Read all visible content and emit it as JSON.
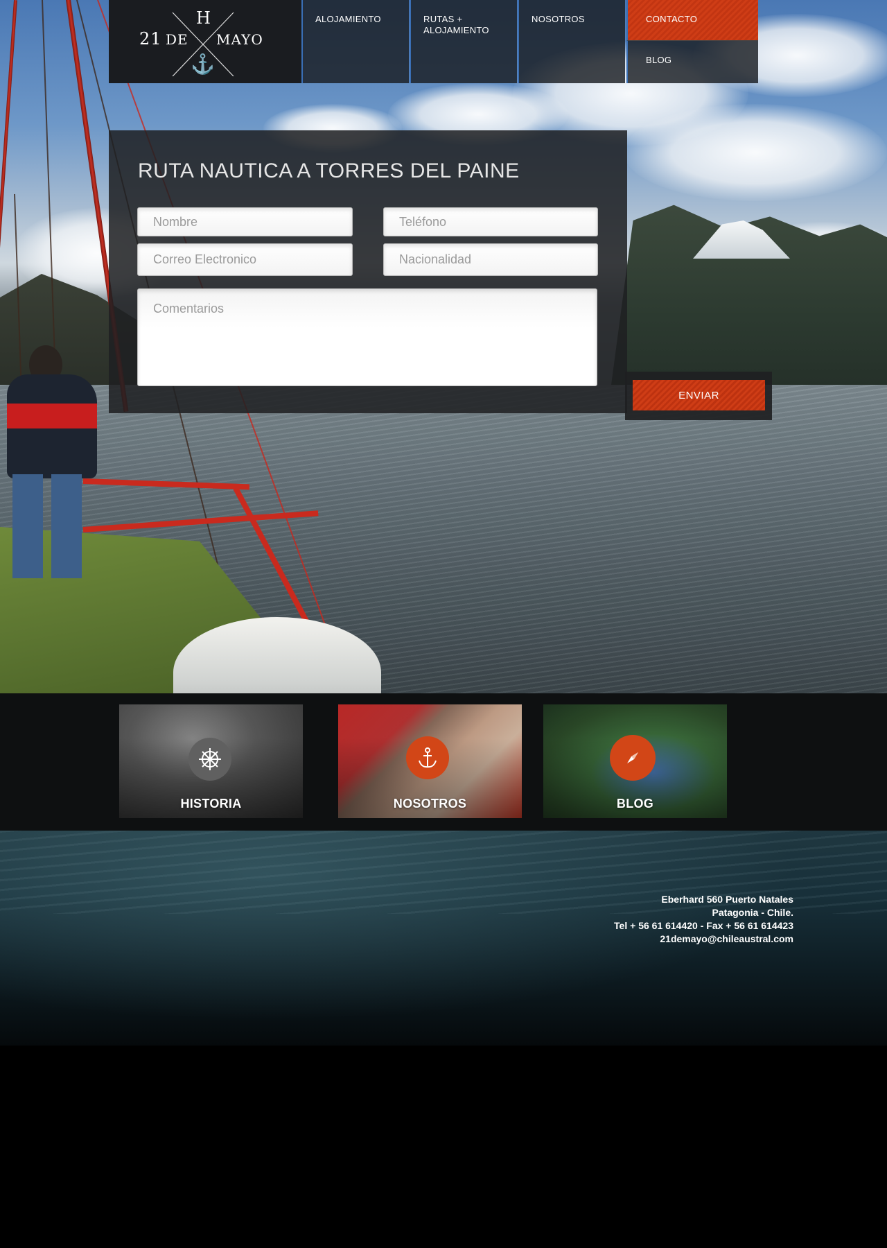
{
  "brand": {
    "logo_h": "H",
    "logo_21": "21",
    "logo_de": "DE",
    "logo_mayo": "MAYO",
    "logo_anchor": "⚓"
  },
  "nav": {
    "items": [
      {
        "label": "ALOJAMIENTO"
      },
      {
        "label": "RUTAS +\nALOJAMIENTO"
      },
      {
        "label": "NOSOTROS"
      },
      {
        "label": "CONTACTO"
      },
      {
        "label": "BLOG"
      }
    ],
    "active": "CONTACTO"
  },
  "form": {
    "title": "RUTA NAUTICA A TORRES DEL PAINE",
    "name_placeholder": "Nombre",
    "phone_placeholder": "Teléfono",
    "email_placeholder": "Correo Electronico",
    "nationality_placeholder": "Nacionalidad",
    "comments_placeholder": "Comentarios",
    "submit_label": "ENVIAR"
  },
  "tiles": [
    {
      "label": "HISTORIA",
      "icon": "ship-wheel-icon"
    },
    {
      "label": "NOSOTROS",
      "icon": "anchor-icon"
    },
    {
      "label": "BLOG",
      "icon": "compass-icon"
    }
  ],
  "footer": {
    "address_line1": "Eberhard 560 Puerto Natales",
    "address_line2": "Patagonia - Chile.",
    "phone_line": "Tel + 56 61 614420 - Fax + 56 61 614423",
    "email": "21demayo@chileaustral.com"
  },
  "colors": {
    "accent": "#d24617",
    "nav_bg": "#1a1d22",
    "nav_divider": "#3a6fb5"
  }
}
